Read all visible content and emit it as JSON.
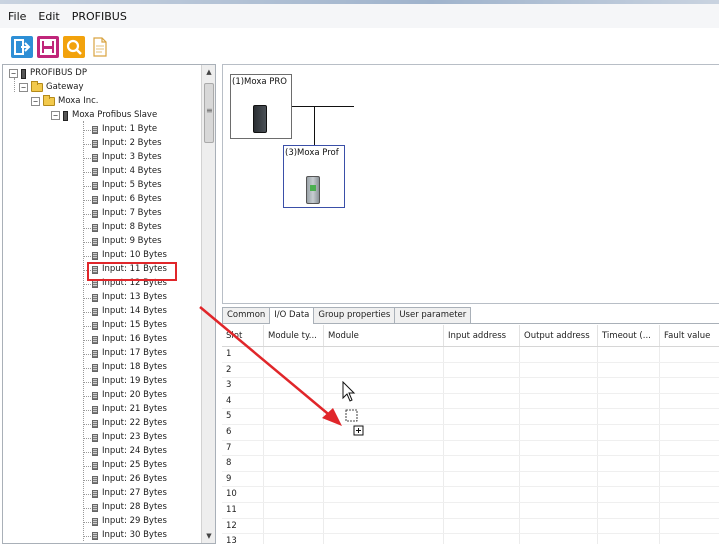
{
  "menu": [
    "File",
    "Edit",
    "PROFIBUS"
  ],
  "toolbar": {
    "icons": [
      "exit-icon",
      "save-icon",
      "search-icon",
      "document-icon"
    ],
    "colors": {
      "exit": "#2e8fd6",
      "save": "#c0267a",
      "search": "#f2a20c",
      "document": "#ffffff"
    }
  },
  "tree": {
    "root": "PROFIBUS DP",
    "gateway": "Gateway",
    "vendor": "Moxa Inc.",
    "slave": "Moxa Profibus Slave",
    "items": [
      "Input: 1 Byte",
      "Input: 2 Bytes",
      "Input: 3 Bytes",
      "Input: 4 Bytes",
      "Input: 5 Bytes",
      "Input: 6 Bytes",
      "Input: 7 Bytes",
      "Input: 8 Bytes",
      "Input: 9 Bytes",
      "Input: 10 Bytes",
      "Input: 11 Bytes",
      "Input: 12 Bytes",
      "Input: 13 Bytes",
      "Input: 14 Bytes",
      "Input: 15 Bytes",
      "Input: 16 Bytes",
      "Input: 17 Bytes",
      "Input: 18 Bytes",
      "Input: 19 Bytes",
      "Input: 20 Bytes",
      "Input: 21 Bytes",
      "Input: 22 Bytes",
      "Input: 23 Bytes",
      "Input: 24 Bytes",
      "Input: 25 Bytes",
      "Input: 26 Bytes",
      "Input: 27 Bytes",
      "Input: 28 Bytes",
      "Input: 29 Bytes",
      "Input: 30 Bytes"
    ],
    "highlighted_item": "Input: 11 Bytes"
  },
  "topology": {
    "device1": "(1)Moxa PRO",
    "device3": "(3)Moxa Prof"
  },
  "tabs": [
    "Common",
    "I/O Data",
    "Group properties",
    "User parameter"
  ],
  "active_tab": "I/O Data",
  "grid": {
    "columns": [
      "Slot",
      "Module ty...",
      "Module",
      "Input address",
      "Output address",
      "Timeout (...",
      "Fault value"
    ],
    "slots": [
      "1",
      "2",
      "3",
      "4",
      "5",
      "6",
      "7",
      "8",
      "9",
      "10",
      "11",
      "12",
      "13"
    ]
  },
  "annotation": {
    "highlight_color": "#e0262a",
    "arrow_color": "#e0262a"
  }
}
